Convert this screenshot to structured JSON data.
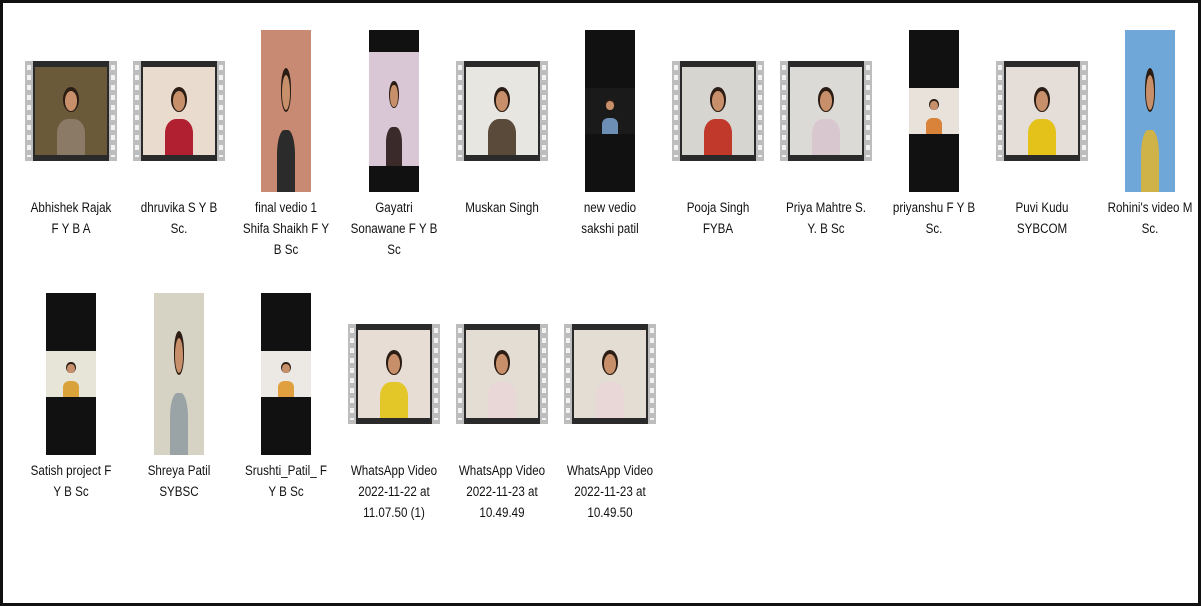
{
  "files": [
    {
      "name": "Abhishek Rajak F Y B A",
      "icon": "film-thumbnail-icon",
      "bg": "#6b5a3a",
      "shirt": "#8a7a66"
    },
    {
      "name": "dhruvika S Y B Sc.",
      "icon": "film-thumbnail-icon",
      "bg": "#e9dccf",
      "shirt": "#b02030"
    },
    {
      "name": "final vedio 1 Shifa Shaikh F Y B Sc",
      "icon": "portrait-thumbnail-icon",
      "bg": "#c98a74",
      "shirt": "#2b2b2b"
    },
    {
      "name": "Gayatri Sonawane F Y B Sc",
      "icon": "portrait-thumbnail-icon",
      "bg": "#d9c7d6",
      "shirt": "#3a2a2a"
    },
    {
      "name": "Muskan Singh",
      "icon": "film-thumbnail-icon",
      "bg": "#e7e6e1",
      "shirt": "#5a4a3a"
    },
    {
      "name": "new vedio sakshi patil",
      "icon": "portrait-thumbnail-icon",
      "bg": "#1a1a1a",
      "shirt": "#6d8fb5"
    },
    {
      "name": "Pooja Singh FYBA",
      "icon": "film-thumbnail-icon",
      "bg": "#d7d5cf",
      "shirt": "#c0392b"
    },
    {
      "name": "Priya Mahtre S. Y. B Sc",
      "icon": "film-thumbnail-icon",
      "bg": "#dcdad6",
      "shirt": "#d9c7d0"
    },
    {
      "name": "priyanshu F Y B Sc.",
      "icon": "portrait-thumbnail-icon",
      "bg": "#e8e2da",
      "shirt": "#d8823a"
    },
    {
      "name": "Puvi Kudu SYBCOM",
      "icon": "film-thumbnail-icon",
      "bg": "#e5ddd8",
      "shirt": "#e4c21a"
    },
    {
      "name": "Rohini's video M Sc.",
      "icon": "portrait-thumbnail-icon",
      "bg": "#6fa7d8",
      "shirt": "#d0b348"
    },
    {
      "name": "Satish project F Y B Sc",
      "icon": "portrait-thumbnail-icon",
      "bg": "#e7e4d8",
      "shirt": "#d9a23a"
    },
    {
      "name": "Shreya Patil SYBSC",
      "icon": "portrait-thumbnail-icon",
      "bg": "#d6d2c4",
      "shirt": "#9aa3a6"
    },
    {
      "name": "Srushti_Patil_ F Y B Sc",
      "icon": "portrait-thumbnail-icon",
      "bg": "#ece9e4",
      "shirt": "#e0a040"
    },
    {
      "name": "WhatsApp Video 2022-11-22 at 11.07.50 (1)",
      "icon": "film-thumbnail-icon",
      "bg": "#e8ddd4",
      "shirt": "#e3c628"
    },
    {
      "name": "WhatsApp Video 2022-11-23 at 10.49.49",
      "icon": "film-thumbnail-icon",
      "bg": "#e4ddd3",
      "shirt": "#e9d6d6"
    },
    {
      "name": "WhatsApp Video 2022-11-23 at 10.49.50",
      "icon": "film-thumbnail-icon",
      "bg": "#e4ddd3",
      "shirt": "#e9d6d6"
    }
  ]
}
